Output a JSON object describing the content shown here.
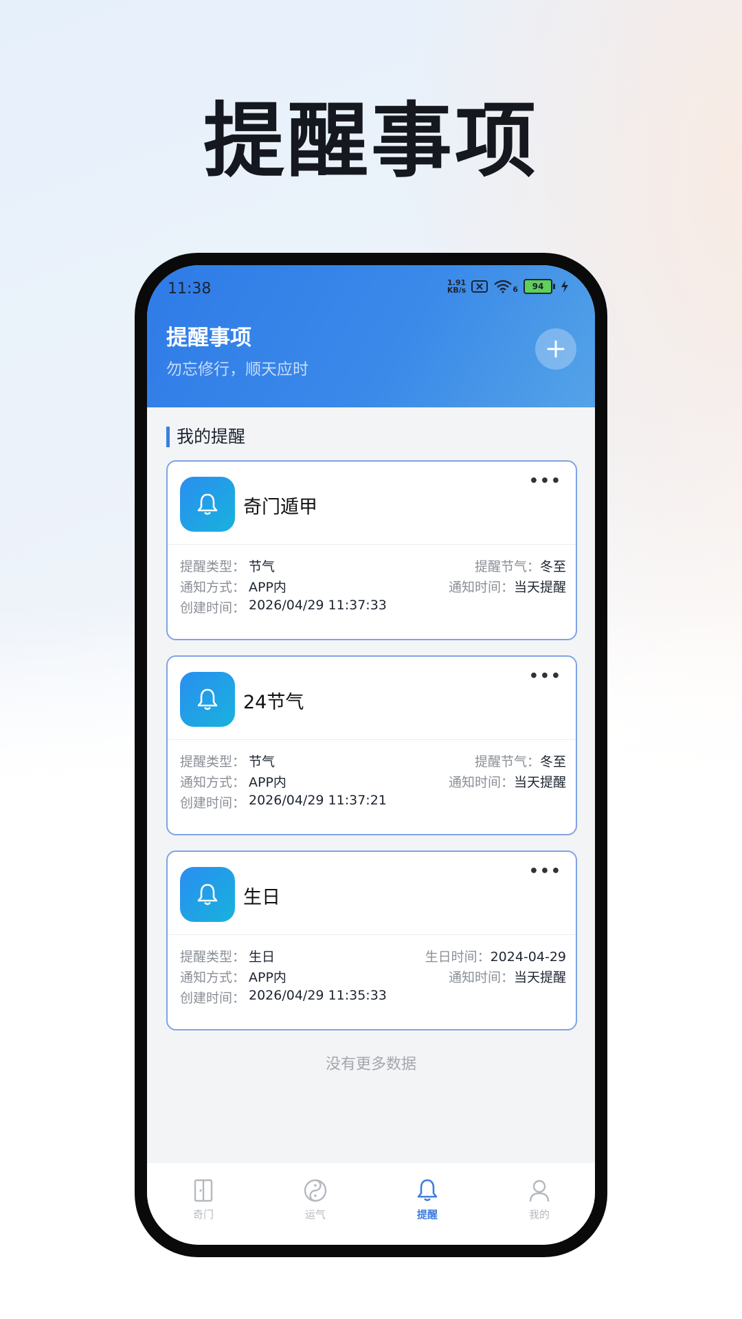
{
  "hero": {
    "title": "提醒事项"
  },
  "status": {
    "time": "11:38",
    "net_speed_value": "1.91",
    "net_speed_unit": "KB/s",
    "wifi_gen": "6",
    "battery": "94"
  },
  "header": {
    "title": "提醒事项",
    "subtitle": "勿忘修行，顺天应时",
    "add_icon": "plus-icon"
  },
  "section": {
    "title": "我的提醒"
  },
  "reminders": [
    {
      "title": "奇门遁甲",
      "rows": [
        {
          "left_label": "提醒类型：",
          "left_value": "节气",
          "right_label": "提醒节气：",
          "right_value": "冬至"
        },
        {
          "left_label": "通知方式：",
          "left_value": "APP内",
          "right_label": "通知时间：",
          "right_value": "当天提醒"
        },
        {
          "left_label": "创建时间：",
          "left_value": "2026/04/29 11:37:33"
        }
      ]
    },
    {
      "title": "24节气",
      "rows": [
        {
          "left_label": "提醒类型：",
          "left_value": "节气",
          "right_label": "提醒节气：",
          "right_value": "冬至"
        },
        {
          "left_label": "通知方式：",
          "left_value": "APP内",
          "right_label": "通知时间：",
          "right_value": "当天提醒"
        },
        {
          "left_label": "创建时间：",
          "left_value": "2026/04/29 11:37:21"
        }
      ]
    },
    {
      "title": "生日",
      "rows": [
        {
          "left_label": "提醒类型：",
          "left_value": "生日",
          "right_label": "生日时间：",
          "right_value": "2024-04-29"
        },
        {
          "left_label": "通知方式：",
          "left_value": "APP内",
          "right_label": "通知时间：",
          "right_value": "当天提醒"
        },
        {
          "left_label": "创建时间：",
          "left_value": "2026/04/29 11:35:33"
        }
      ]
    }
  ],
  "card_more": "•••",
  "no_more": "没有更多数据",
  "tabs": [
    {
      "label": "奇门",
      "icon": "door-icon",
      "active": false
    },
    {
      "label": "运气",
      "icon": "yin-yang-icon",
      "active": false
    },
    {
      "label": "提醒",
      "icon": "bell-icon",
      "active": true
    },
    {
      "label": "我的",
      "icon": "user-icon",
      "active": false
    }
  ],
  "colors": {
    "accent": "#3c7de0",
    "header_start": "#2f7be8",
    "header_end": "#64b3e6",
    "card_border": "#7ea3e6"
  }
}
